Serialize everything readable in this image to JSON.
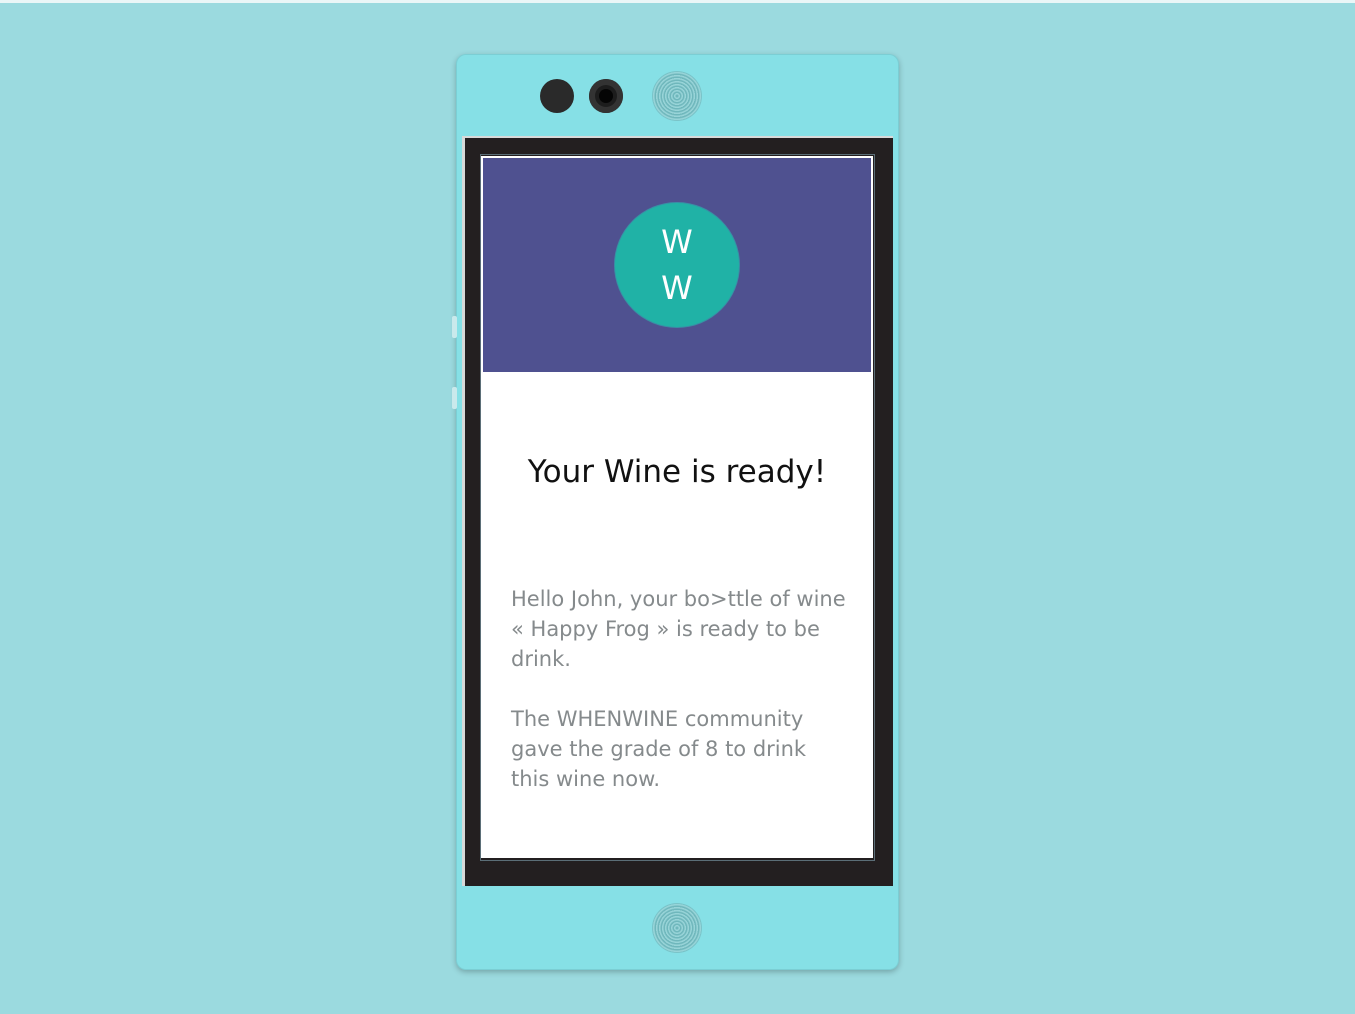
{
  "app": {
    "logo_line1": "W",
    "logo_line2": "W",
    "title": "Your Wine is ready!",
    "paragraph1": "Hello John, your bo>ttle of wine « Happy Frog » is ready to be drink.",
    "paragraph2": "The WHENWINE community gave the grade of 8 to drink this wine now."
  },
  "colors": {
    "background": "#9bdadf",
    "phone_body": "#86e0e6",
    "header": "#4f5190",
    "logo": "#20b2a6",
    "body_text": "#858a8c"
  }
}
